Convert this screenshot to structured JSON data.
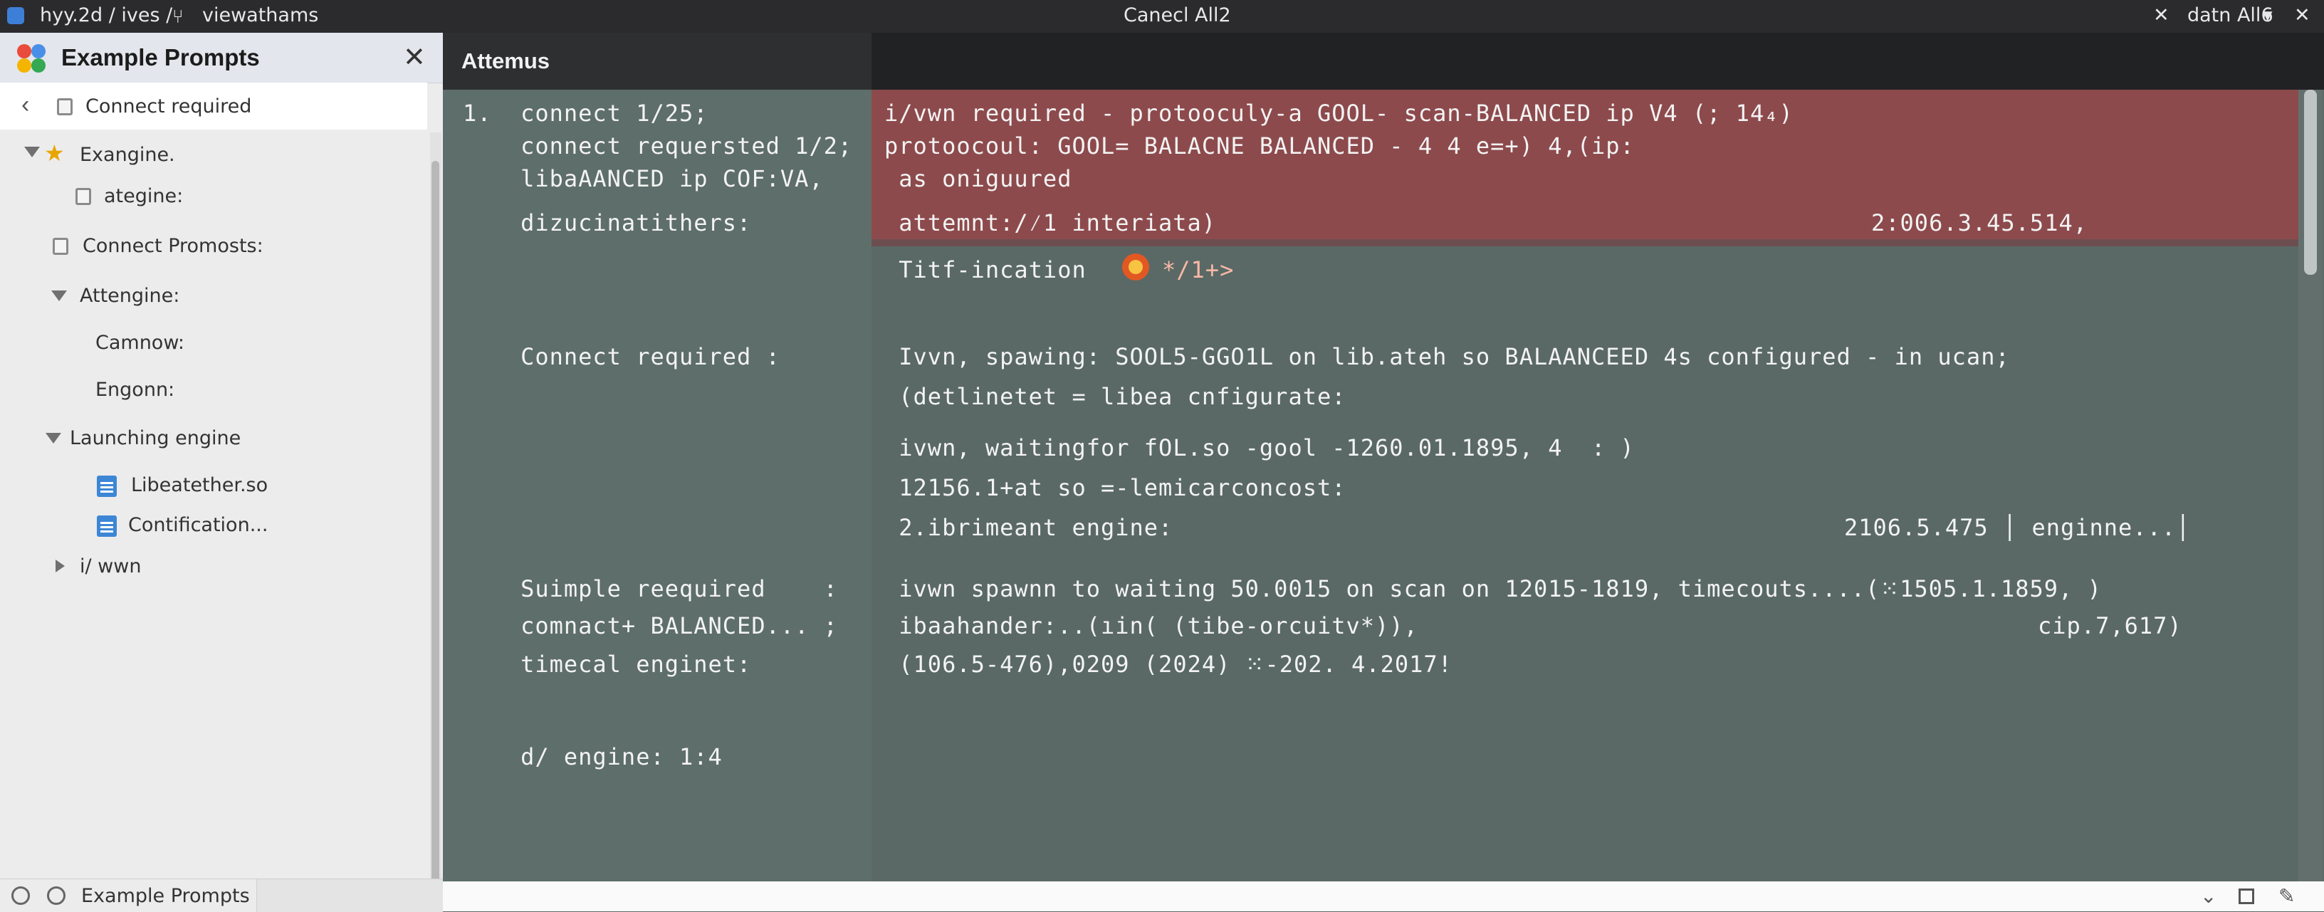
{
  "titlebar": {
    "path": "hyy.2d / ives /",
    "view": "viewathams",
    "center": "Canecl All2",
    "right": "datn All6",
    "caret": "▾",
    "close": "✕"
  },
  "sidebar": {
    "title": "Example Prompts",
    "close": "✕",
    "back": "Connect required",
    "items": [
      {
        "label": "Exangine."
      },
      {
        "label": "ategine:"
      },
      {
        "label": "Connect Promosts:"
      },
      {
        "label": "Attengine:"
      },
      {
        "label": "Camnow:"
      },
      {
        "label": "Engonn:"
      },
      {
        "label": "Launching engine"
      },
      {
        "label": "Libeatether.so"
      },
      {
        "label": "Contification..."
      },
      {
        "label": "i/ wwn"
      }
    ],
    "footer_tab": "Example Prompts"
  },
  "main": {
    "header": "Attemus",
    "left_lines": [
      "1.  connect 1/25;",
      "    connect requersted 1/2;",
      "    libaAANCED ip COF:VA,",
      "    dizucinatithers:",
      "    Connect required :",
      "    Suimple reequired    :",
      "    comnact+ BALANCED... ;",
      "    timecal enginet:",
      "    d/ engine: 1:4"
    ],
    "right_lines": [
      "i/vwn required - protooculy-a GOOL- scan-BALANCED ip V4 (; 14₄)",
      "protoocoul: GOOL= BALACNE BALANCED - 4 4 e=+) 4,(ip:",
      " as oniguured",
      " attemnt:/⁄1 interiata)",
      "2:006.3.45.514,",
      " Titf-incation",
      "*/1+>",
      " Ivvn, spawing: SOOL5-GGO1L on lib.ateh so BALAANCEED 4s configured - in ucan;",
      " (detlinetet = libea cnfigurate:",
      " ivwn, waitingfor fOL.so -gool -1260.01.1895, 4  : )",
      " 12156.1+at so =-lemicarconcost:",
      " 2.ibrimeant engine:",
      "2106.5.475 │ enginne...│",
      " ivwn spawnn to waiting 50.0015 on scan on 12015-1819, timecouts....(⁙1505.1.1859, )",
      " ibaahander:..(ıin( (tibe-orcuitv*)),",
      "cip.7,617)",
      " (106.5-476),0209 (2024) ⁙-202. 4.2017!"
    ]
  },
  "colors": {
    "highlight": "#8d4a4c",
    "editor_bg": "#5a6966",
    "titlebar_bg": "#2b2b2d"
  }
}
